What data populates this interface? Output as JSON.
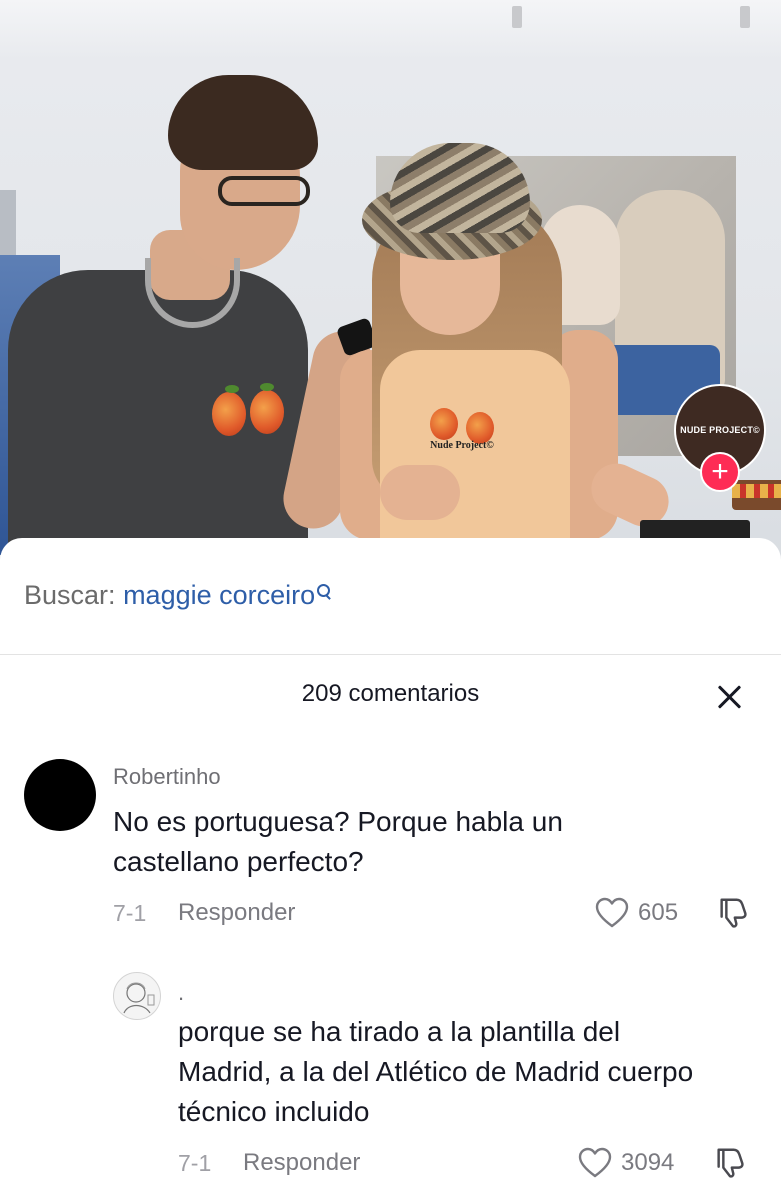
{
  "video": {
    "brand_label": "NUDE PROJECT©",
    "shirt_print": "Nude Project©"
  },
  "search": {
    "prefix": "Buscar:",
    "term": "maggie corceiro"
  },
  "comments_header": {
    "title": "209 comentarios"
  },
  "comments": [
    {
      "username": "Robertinho",
      "text": "No es portuguesa? Porque habla un castellano perfecto?",
      "date": "7-1",
      "reply_label": "Responder",
      "likes": "605"
    },
    {
      "username": ".",
      "text": "porque se ha tirado a la plantilla del Madrid, a la del Atlético de Madrid cuerpo técnico incluido",
      "date": "7-1",
      "reply_label": "Responder",
      "likes": "3094"
    }
  ],
  "colors": {
    "accent_link": "#2e5ea8",
    "follow_button": "#fe2c55",
    "text_primary": "#161823",
    "text_secondary": "#7a7a80"
  },
  "icons": {
    "close": "close-icon",
    "search": "search-icon",
    "like": "heart-icon",
    "dislike": "thumbs-down-icon",
    "follow": "plus-icon"
  }
}
